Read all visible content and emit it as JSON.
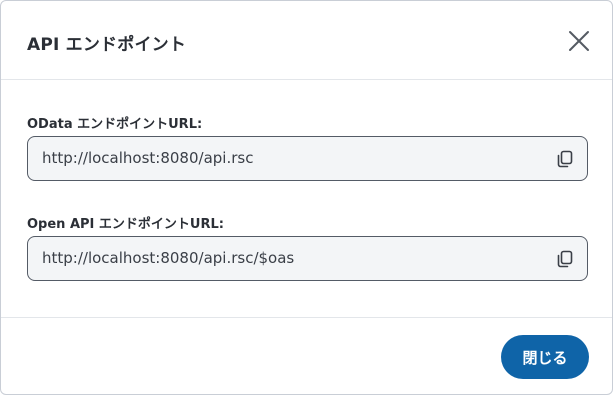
{
  "dialog": {
    "title": "API エンドポイント",
    "close_icon": "close-icon"
  },
  "fields": [
    {
      "label": "OData エンドポイントURL:",
      "value": "http://localhost:8080/api.rsc",
      "icon": "copy-icon"
    },
    {
      "label": "Open API エンドポイントURL:",
      "value": "http://localhost:8080/api.rsc/$oas",
      "icon": "copy-icon"
    }
  ],
  "footer": {
    "close_label": "閉じる"
  },
  "colors": {
    "primary_button": "#0f64a8",
    "field_background": "#f3f5f7",
    "field_border": "#545b66",
    "text": "#2b2f36"
  }
}
